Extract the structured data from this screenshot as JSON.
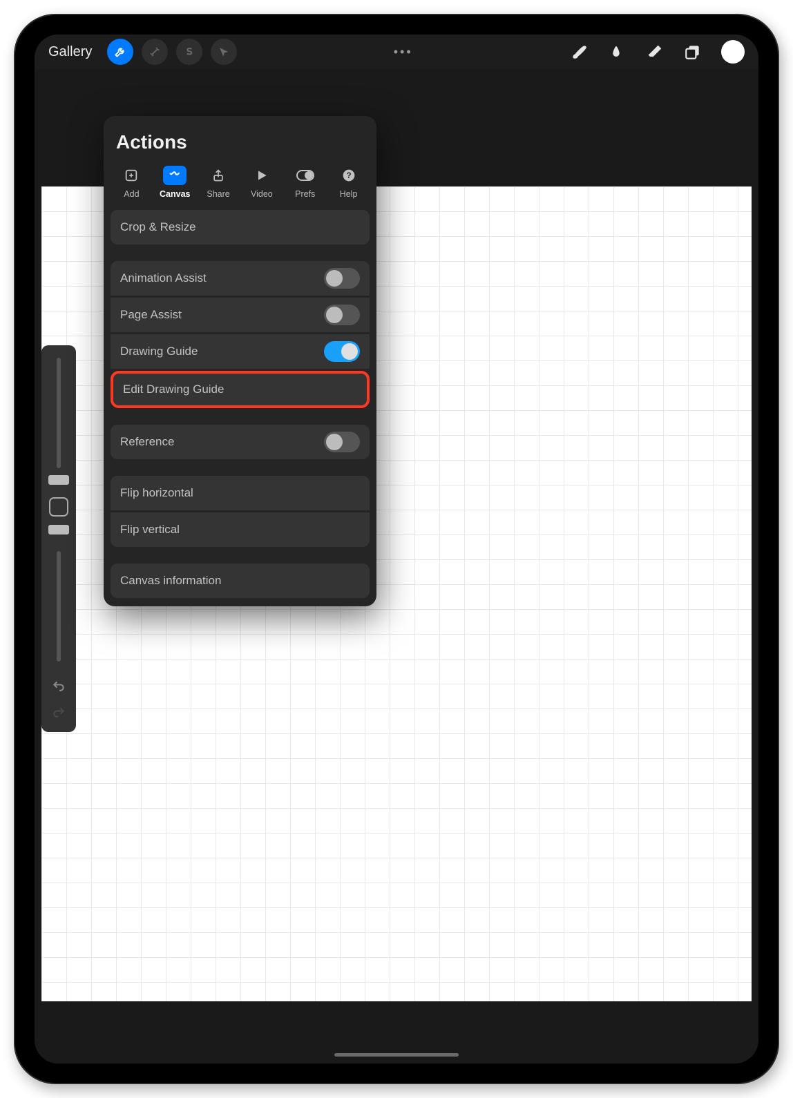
{
  "toolbar": {
    "gallery": "Gallery"
  },
  "panel": {
    "title": "Actions",
    "tabs": [
      {
        "label": "Add"
      },
      {
        "label": "Canvas"
      },
      {
        "label": "Share"
      },
      {
        "label": "Video"
      },
      {
        "label": "Prefs"
      },
      {
        "label": "Help"
      }
    ],
    "rows": {
      "crop": "Crop & Resize",
      "anim": "Animation Assist",
      "page": "Page Assist",
      "guide": "Drawing Guide",
      "editGuide": "Edit Drawing Guide",
      "reference": "Reference",
      "flipH": "Flip horizontal",
      "flipV": "Flip vertical",
      "info": "Canvas information"
    },
    "toggles": {
      "anim": false,
      "page": false,
      "guide": true,
      "reference": false
    }
  }
}
